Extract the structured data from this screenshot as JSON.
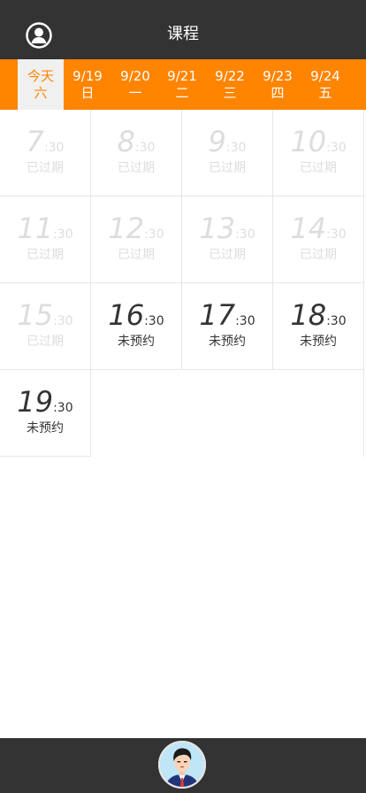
{
  "header": {
    "title": "课程",
    "profile_icon": "user-circle-icon"
  },
  "date_tabs": [
    {
      "date": "今天",
      "weekday": "六",
      "active": true
    },
    {
      "date": "9/19",
      "weekday": "日",
      "active": false
    },
    {
      "date": "9/20",
      "weekday": "一",
      "active": false
    },
    {
      "date": "9/21",
      "weekday": "二",
      "active": false
    },
    {
      "date": "9/22",
      "weekday": "三",
      "active": false
    },
    {
      "date": "9/23",
      "weekday": "四",
      "active": false
    },
    {
      "date": "9/24",
      "weekday": "五",
      "active": false
    }
  ],
  "slots": [
    {
      "hour": "7",
      "minute": ":30",
      "status": "已过期",
      "expired": true
    },
    {
      "hour": "8",
      "minute": ":30",
      "status": "已过期",
      "expired": true
    },
    {
      "hour": "9",
      "minute": ":30",
      "status": "已过期",
      "expired": true
    },
    {
      "hour": "10",
      "minute": ":30",
      "status": "已过期",
      "expired": true
    },
    {
      "hour": "11",
      "minute": ":30",
      "status": "已过期",
      "expired": true
    },
    {
      "hour": "12",
      "minute": ":30",
      "status": "已过期",
      "expired": true
    },
    {
      "hour": "13",
      "minute": ":30",
      "status": "已过期",
      "expired": true
    },
    {
      "hour": "14",
      "minute": ":30",
      "status": "已过期",
      "expired": true
    },
    {
      "hour": "15",
      "minute": ":30",
      "status": "已过期",
      "expired": true
    },
    {
      "hour": "16",
      "minute": ":30",
      "status": "未预约",
      "expired": false
    },
    {
      "hour": "17",
      "minute": ":30",
      "status": "未预约",
      "expired": false
    },
    {
      "hour": "18",
      "minute": ":30",
      "status": "未预约",
      "expired": false
    },
    {
      "hour": "19",
      "minute": ":30",
      "status": "未预约",
      "expired": false
    }
  ],
  "colors": {
    "header_bg": "#333333",
    "accent": "#ff8400",
    "expired_text": "#dddddd",
    "open_text": "#333333"
  },
  "bottom": {
    "avatar_icon": "coach-avatar-icon"
  }
}
